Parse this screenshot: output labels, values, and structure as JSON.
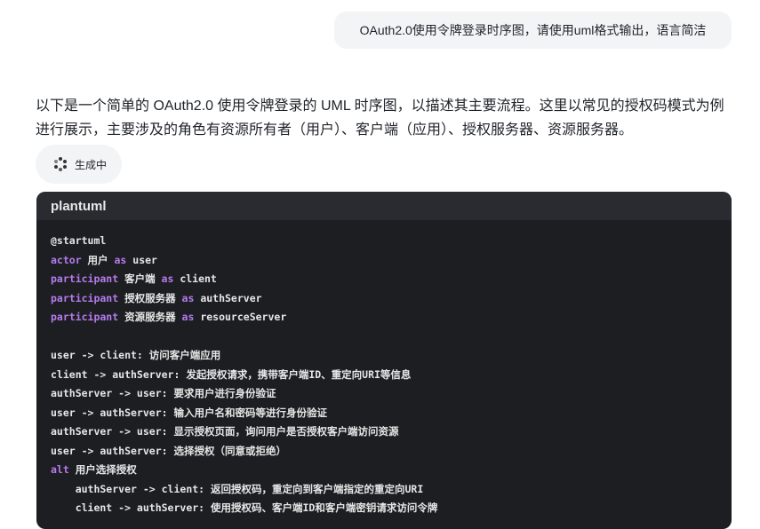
{
  "user_message": "OAuth2.0使用令牌登录时序图，请使用uml格式输出，语言简洁",
  "answer_text": "以下是一个简单的 OAuth2.0 使用令牌登录的 UML 时序图，以描述其主要流程。这里以常见的授权码模式为例进行展示，主要涉及的角色有资源所有者（用户）、客户端（应用）、授权服务器、资源服务器。",
  "status": {
    "label": "生成中",
    "icon": "loading-spinner-icon"
  },
  "code_block": {
    "language": "plantuml",
    "lines": [
      [
        {
          "t": "@startuml"
        }
      ],
      [
        {
          "t": "actor",
          "k": 1
        },
        {
          "t": " 用户 "
        },
        {
          "t": "as",
          "k": 1
        },
        {
          "t": " user"
        }
      ],
      [
        {
          "t": "participant",
          "k": 1
        },
        {
          "t": " 客户端 "
        },
        {
          "t": "as",
          "k": 1
        },
        {
          "t": " client"
        }
      ],
      [
        {
          "t": "participant",
          "k": 1
        },
        {
          "t": " 授权服务器 "
        },
        {
          "t": "as",
          "k": 1
        },
        {
          "t": " authServer"
        }
      ],
      [
        {
          "t": "participant",
          "k": 1
        },
        {
          "t": " 资源服务器 "
        },
        {
          "t": "as",
          "k": 1
        },
        {
          "t": " resourceServer"
        }
      ],
      [
        {
          "t": ""
        }
      ],
      [
        {
          "t": "user -> client: 访问客户端应用"
        }
      ],
      [
        {
          "t": "client -> authServer: 发起授权请求，携带客户端ID、重定向URI等信息"
        }
      ],
      [
        {
          "t": "authServer -> user: 要求用户进行身份验证"
        }
      ],
      [
        {
          "t": "user -> authServer: 输入用户名和密码等进行身份验证"
        }
      ],
      [
        {
          "t": "authServer -> user: 显示授权页面，询问用户是否授权客户端访问资源"
        }
      ],
      [
        {
          "t": "user -> authServer: 选择授权（同意或拒绝）"
        }
      ],
      [
        {
          "t": "alt",
          "k": 1
        },
        {
          "t": " 用户选择授权"
        }
      ],
      [
        {
          "t": "    authServer -> client: 返回授权码，重定向到客户端指定的重定向URI"
        }
      ],
      [
        {
          "t": "    client -> authServer: 使用授权码、客户端ID和客户端密钥请求访问令牌"
        }
      ]
    ]
  },
  "colors": {
    "keyword": "#b57bed",
    "code_bg": "#1d1e22",
    "code_header_bg": "#2a2b30"
  }
}
